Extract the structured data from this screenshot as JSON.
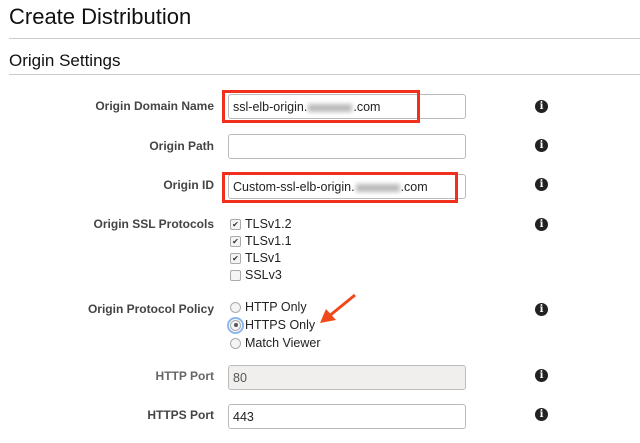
{
  "page": {
    "title": "Create Distribution",
    "section": "Origin Settings"
  },
  "fields": {
    "origin_domain_name": {
      "label": "Origin Domain Name",
      "value_prefix": "ssl-elb-origin.",
      "value_suffix": ".com"
    },
    "origin_path": {
      "label": "Origin Path",
      "value": ""
    },
    "origin_id": {
      "label": "Origin ID",
      "value_prefix": "Custom-ssl-elb-origin.",
      "value_suffix": ".com"
    },
    "ssl_protocols": {
      "label": "Origin SSL Protocols",
      "options": [
        {
          "label": "TLSv1.2",
          "checked": true
        },
        {
          "label": "TLSv1.1",
          "checked": true
        },
        {
          "label": "TLSv1",
          "checked": true
        },
        {
          "label": "SSLv3",
          "checked": false
        }
      ]
    },
    "protocol_policy": {
      "label": "Origin Protocol Policy",
      "options": [
        {
          "label": "HTTP Only"
        },
        {
          "label": "HTTPS Only"
        },
        {
          "label": "Match Viewer"
        }
      ],
      "selected": "HTTPS Only"
    },
    "http_port": {
      "label": "HTTP Port",
      "value": "80"
    },
    "https_port": {
      "label": "HTTPS Port",
      "value": "443"
    }
  },
  "icons": {
    "info": "i"
  },
  "colors": {
    "highlight": "#f0301c",
    "arrow": "#f04a1c"
  }
}
